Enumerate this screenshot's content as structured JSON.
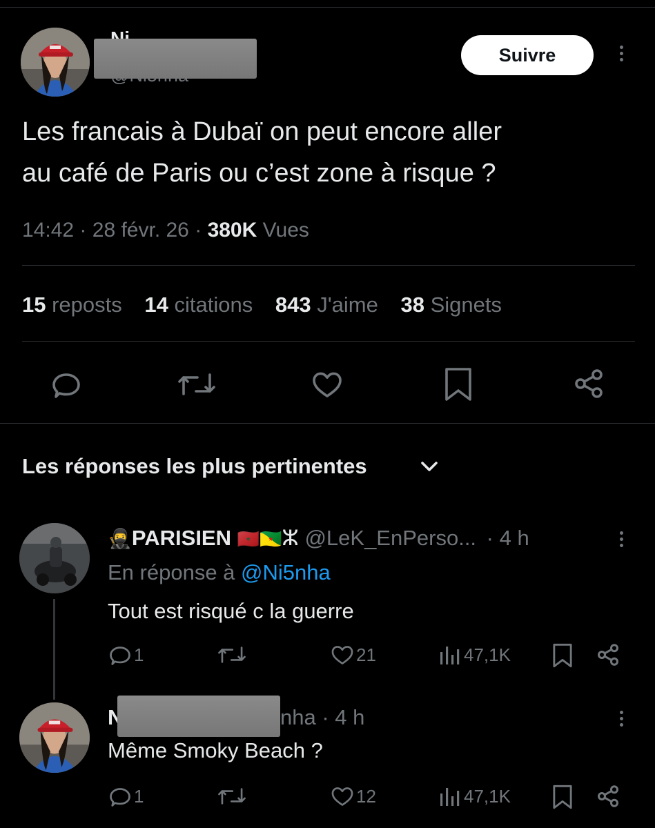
{
  "tweet": {
    "author_name": "Ni",
    "author_handle": "@Ni5nha",
    "text_line1": "Les francais à Dubaï on peut encore aller",
    "text_line2": "au café de Paris ou c’est zone à risque ?",
    "time": "14:42",
    "sep1": "·",
    "date": "28 févr. 26",
    "sep2": "·",
    "views_count": "380K",
    "views_label": "Vues",
    "follow_label": "Suivre"
  },
  "stats": {
    "reposts_count": "15",
    "reposts_label": "reposts",
    "quotes_count": "14",
    "quotes_label": "citations",
    "likes_count": "843",
    "likes_label": "J'aime",
    "bookmarks_count": "38",
    "bookmarks_label": "Signets"
  },
  "replies_header": {
    "label": "Les réponses les plus pertinentes"
  },
  "replies": [
    {
      "emoji": "🥷",
      "name": "PARISIEN",
      "flags": "🇲🇦🇬🇫",
      "tifinagh": "ⵣ",
      "handle": "@LeK_EnPerso...",
      "time": "· 4 h",
      "in_reply_prefix": "En réponse à",
      "in_reply_handle": "@Ni5nha",
      "text": "Tout est risqué c la guerre",
      "reply_count": "1",
      "like_count": "21",
      "views": "47,1K"
    },
    {
      "name_start": "N",
      "handle_end": "nha",
      "time": "· 4 h",
      "text": "Même Smoky Beach ?",
      "reply_count": "1",
      "like_count": "12",
      "views": "47,1K"
    }
  ],
  "colors": {
    "background": "#000000",
    "text": "#e7e9ea",
    "muted": "#71767b",
    "link": "#1d9bf0",
    "divider": "#2f3336"
  }
}
